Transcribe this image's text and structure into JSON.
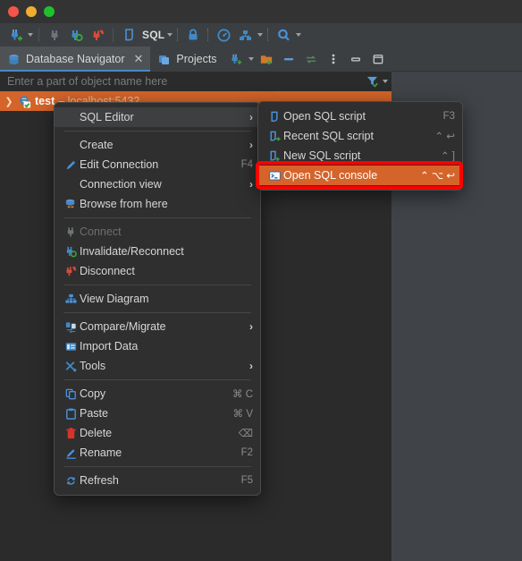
{
  "window": {
    "traffic_lights": [
      "close",
      "minimize",
      "zoom"
    ]
  },
  "toolbar": {
    "items": [
      {
        "name": "new-connection-icon",
        "label": "",
        "dropdown": true
      },
      {
        "name": "connect-icon",
        "label": ""
      },
      {
        "name": "reconnect-icon",
        "label": ""
      },
      {
        "name": "disconnect-icon",
        "label": ""
      },
      {
        "name": "sql-editor-icon",
        "label": "SQL",
        "dropdown": true
      },
      {
        "name": "commit-lock-icon",
        "label": ""
      },
      {
        "name": "transaction-mode-icon",
        "label": ""
      },
      {
        "name": "database-tasks-icon",
        "label": "",
        "dropdown": true
      },
      {
        "name": "search-icon",
        "label": "",
        "dropdown": true
      }
    ],
    "sql_label": "SQL"
  },
  "tool_window": {
    "tabs": [
      {
        "label": "Database Navigator",
        "active": true,
        "closable": true
      },
      {
        "label": "Projects",
        "active": false,
        "closable": false
      }
    ],
    "actions": [
      {
        "name": "new-connection-icon"
      },
      {
        "name": "new-folder-icon"
      },
      {
        "name": "collapse-all-icon"
      },
      {
        "name": "link-editor-icon"
      },
      {
        "name": "more-options-icon"
      },
      {
        "name": "minimize-window-icon"
      },
      {
        "name": "maximize-window-icon"
      }
    ]
  },
  "filter": {
    "placeholder": "Enter a part of object name here",
    "value": "",
    "filter_icon": "filter-icon"
  },
  "tree": {
    "rows": [
      {
        "expander": "❯",
        "icon": "postgresql-connection-icon",
        "name": "test",
        "detail": "– localhost:5432",
        "selected": true
      }
    ]
  },
  "context_menu": {
    "items": [
      {
        "label": "SQL Editor",
        "icon": null,
        "shortcut": "",
        "submenu": true,
        "hover": true,
        "disabled": false
      },
      {
        "separator": true
      },
      {
        "label": "Create",
        "icon": null,
        "shortcut": "",
        "submenu": true,
        "hover": false,
        "disabled": false
      },
      {
        "label": "Edit Connection",
        "icon": "pencil-icon",
        "shortcut": "F4",
        "submenu": false,
        "hover": false,
        "disabled": false
      },
      {
        "label": "Connection view",
        "icon": null,
        "shortcut": "",
        "submenu": true,
        "hover": false,
        "disabled": false
      },
      {
        "label": "Browse from here",
        "icon": "database-browse-icon",
        "shortcut": "",
        "submenu": false,
        "hover": false,
        "disabled": false
      },
      {
        "separator": true
      },
      {
        "label": "Connect",
        "icon": "plug-grey-icon",
        "shortcut": "",
        "submenu": false,
        "hover": false,
        "disabled": true
      },
      {
        "label": "Invalidate/Reconnect",
        "icon": "plug-refresh-icon",
        "shortcut": "",
        "submenu": false,
        "hover": false,
        "disabled": false
      },
      {
        "label": "Disconnect",
        "icon": "plug-broken-icon",
        "shortcut": "",
        "submenu": false,
        "hover": false,
        "disabled": false
      },
      {
        "separator": true
      },
      {
        "label": "View Diagram",
        "icon": "diagram-icon",
        "shortcut": "",
        "submenu": false,
        "hover": false,
        "disabled": false
      },
      {
        "separator": true
      },
      {
        "label": "Compare/Migrate",
        "icon": "compare-icon",
        "shortcut": "",
        "submenu": true,
        "hover": false,
        "disabled": false
      },
      {
        "label": "Import Data",
        "icon": "import-icon",
        "shortcut": "",
        "submenu": false,
        "hover": false,
        "disabled": false
      },
      {
        "label": "Tools",
        "icon": "tools-icon",
        "shortcut": "",
        "submenu": true,
        "hover": false,
        "disabled": false
      },
      {
        "separator": true
      },
      {
        "label": "Copy",
        "icon": "copy-icon",
        "shortcut": "⌘ C",
        "submenu": false,
        "hover": false,
        "disabled": false
      },
      {
        "label": "Paste",
        "icon": "paste-icon",
        "shortcut": "⌘ V",
        "submenu": false,
        "hover": false,
        "disabled": false
      },
      {
        "label": "Delete",
        "icon": "trash-icon",
        "shortcut": "⌫",
        "submenu": false,
        "hover": false,
        "disabled": false
      },
      {
        "label": "Rename",
        "icon": "rename-icon",
        "shortcut": "F2",
        "submenu": false,
        "hover": false,
        "disabled": false
      },
      {
        "separator": true
      },
      {
        "label": "Refresh",
        "icon": "refresh-icon",
        "shortcut": "F5",
        "submenu": false,
        "hover": false,
        "disabled": false
      }
    ]
  },
  "submenu": {
    "items": [
      {
        "label": "Open SQL script",
        "icon": "sql-script-open-icon",
        "shortcut": "F3",
        "selected": false
      },
      {
        "label": "Recent SQL script",
        "icon": "sql-script-recent-icon",
        "shortcut": "⌃ ↩",
        "selected": false
      },
      {
        "label": "New SQL script",
        "icon": "sql-script-new-icon",
        "shortcut": "⌃ ]",
        "selected": false
      },
      {
        "label": "Open SQL console",
        "icon": "sql-console-icon",
        "shortcut": "⌃ ⌥ ↩",
        "selected": true
      }
    ]
  },
  "annotation": {
    "type": "highlight-box",
    "color": "#ff0000",
    "target": "Open SQL console"
  }
}
